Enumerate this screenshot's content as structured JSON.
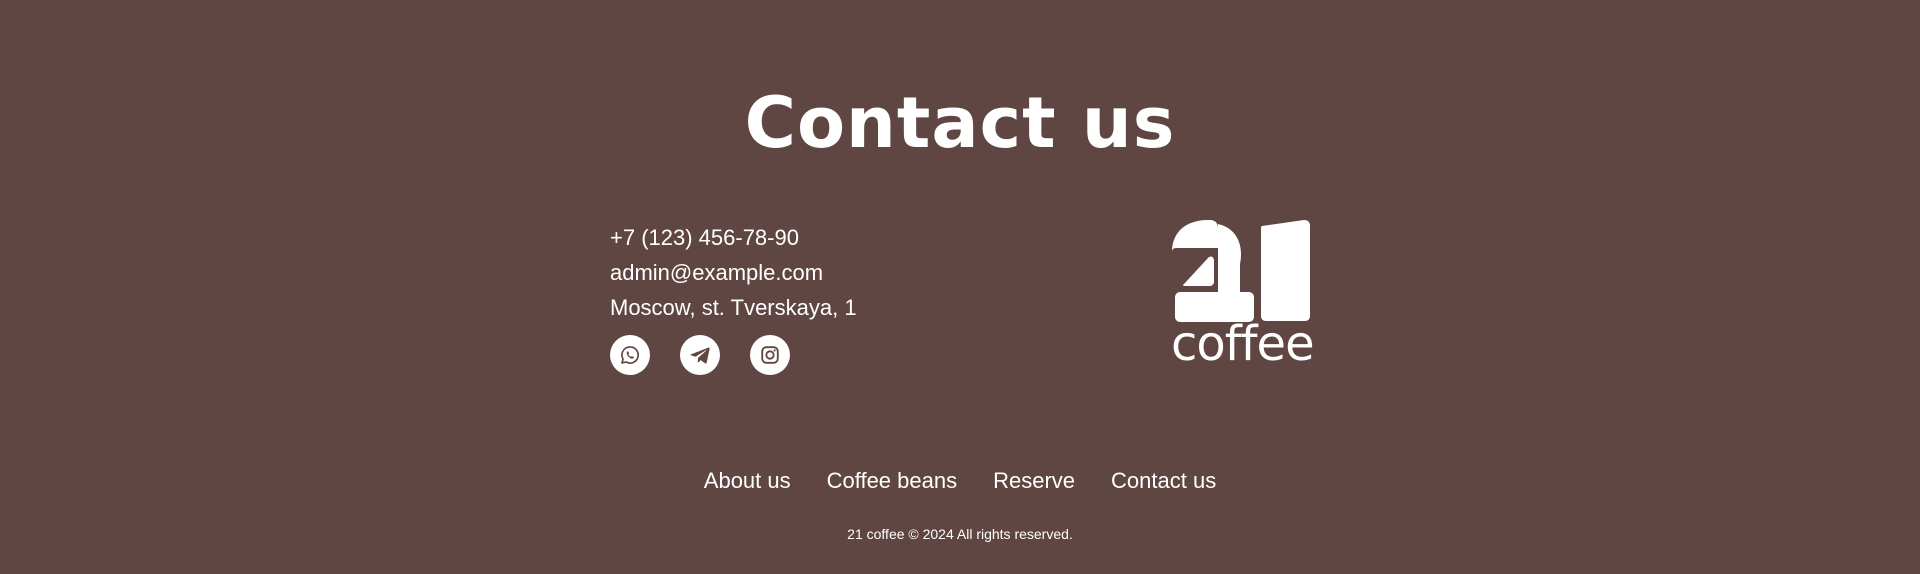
{
  "page": {
    "title": "Contact us",
    "background_color": "#604643",
    "text_color": "#ffffff"
  },
  "contacts": {
    "phone": "+7 (123) 456-78-90",
    "email": "admin@example.com",
    "address": "Moscow, st. Tverskaya, 1"
  },
  "socials": [
    {
      "name": "whatsapp",
      "icon": "whatsapp-icon"
    },
    {
      "name": "telegram",
      "icon": "telegram-icon"
    },
    {
      "name": "instagram",
      "icon": "instagram-icon"
    }
  ],
  "logo": {
    "number_mark": "21",
    "word": "coffee"
  },
  "nav": {
    "about": "About us",
    "coffee_beans": "Coffee beans",
    "reserve": "Reserve",
    "contact": "Contact us"
  },
  "footer": {
    "copyright": "21 coffee © 2024 All rights reserved."
  }
}
